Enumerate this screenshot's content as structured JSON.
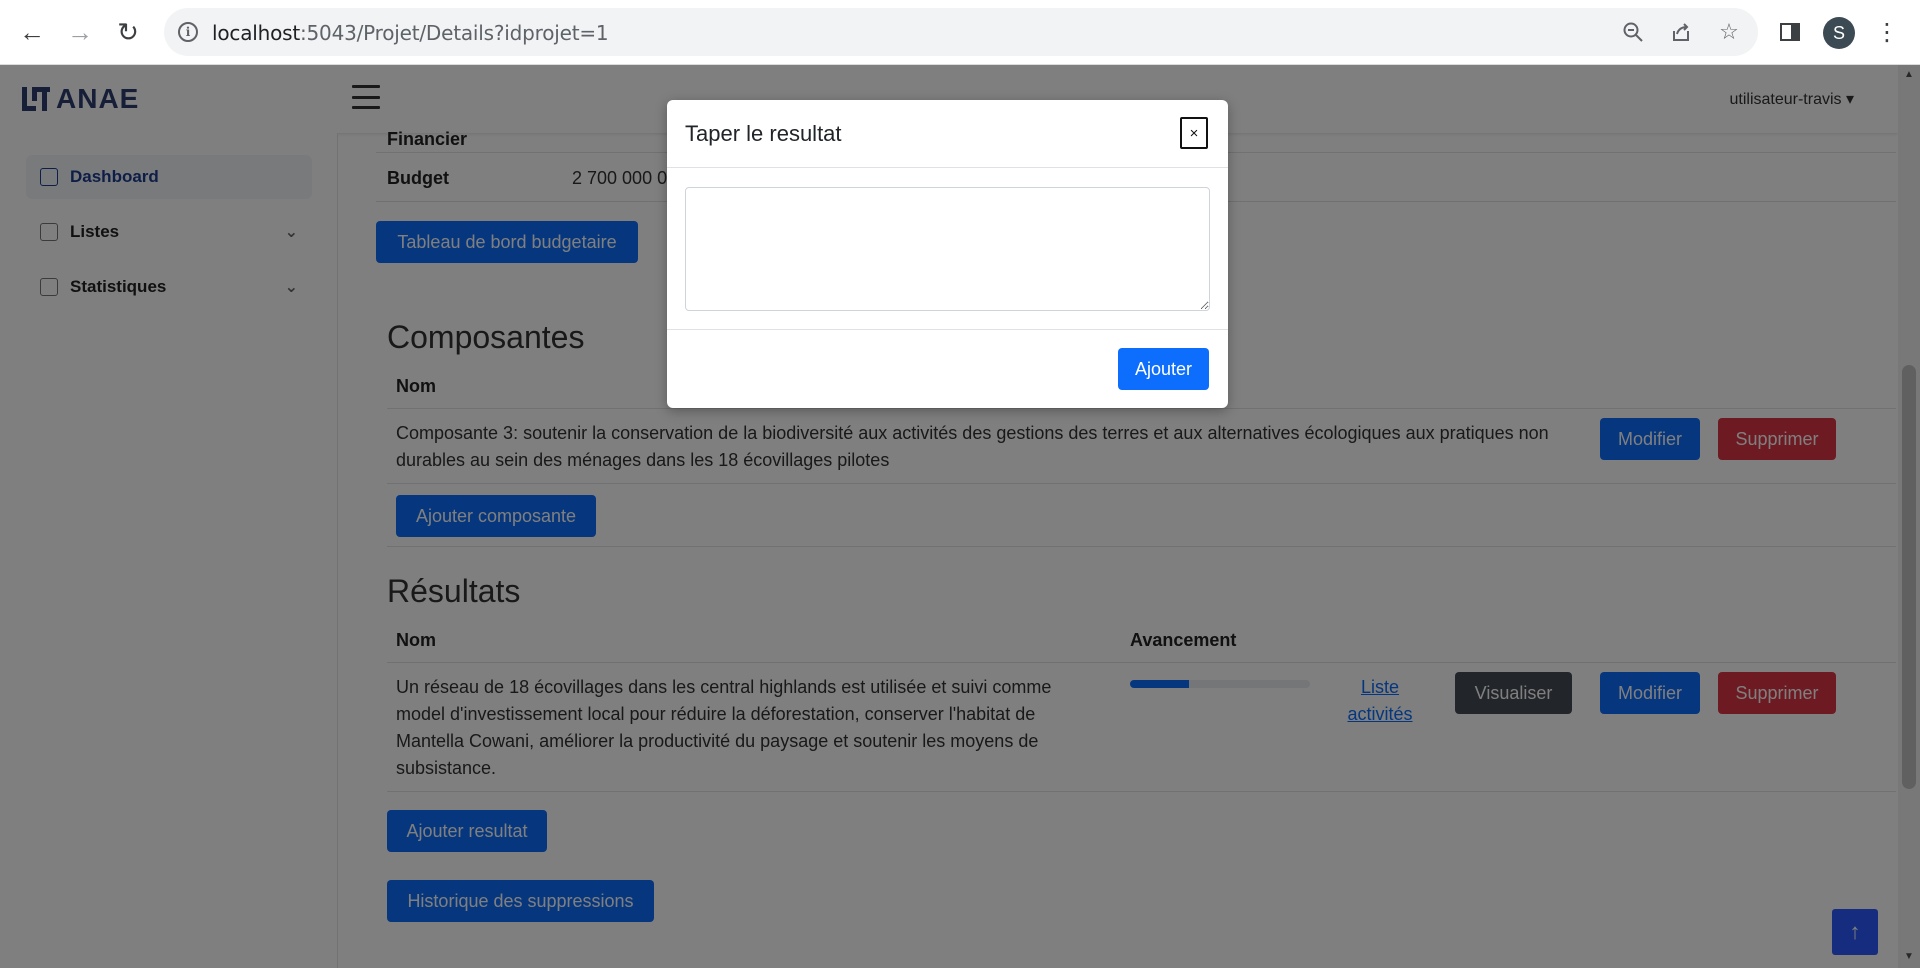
{
  "browser": {
    "url_host": "localhost",
    "url_path": ":5043/Projet/Details?idprojet=1",
    "profile_initial": "S"
  },
  "app": {
    "logo_text": "ANAE",
    "user_menu": "utilisateur-travis ▾"
  },
  "sidebar": {
    "items": [
      {
        "label": "Dashboard"
      },
      {
        "label": "Listes"
      },
      {
        "label": "Statistiques"
      }
    ]
  },
  "project": {
    "partial_label": "Financier",
    "budget_label": "Budget",
    "budget_value": "2 700 000 0",
    "dashboard_button": "Tableau de bord budgetaire"
  },
  "composantes": {
    "title": "Composantes",
    "col_nom": "Nom",
    "rows": [
      {
        "nom": "Composante 3: soutenir la conservation de la biodiversité aux activités des gestions des terres et aux alternatives écologiques aux pratiques non durables au sein des ménages dans les 18 écovillages pilotes"
      }
    ],
    "edit_label": "Modifier",
    "delete_label": "Supprimer",
    "add_button": "Ajouter composante"
  },
  "resultats": {
    "title": "Résultats",
    "col_nom": "Nom",
    "col_avancement": "Avancement",
    "rows": [
      {
        "nom": "Un réseau de 18 écovillages dans les central highlands est utilisée et suivi comme model d'investissement local pour réduire la déforestation, conserver l'habitat de Mantella Cowani, améliorer la productivité du paysage et soutenir les moyens de subsistance.",
        "avancement": 0.33,
        "activities_link": "Liste activités",
        "view_label": "Visualiser",
        "edit_label": "Modifier",
        "delete_label": "Supprimer"
      }
    ],
    "add_button": "Ajouter resultat",
    "history_button": "Historique des suppressions"
  },
  "modal": {
    "title": "Taper le resultat",
    "close_label": "×",
    "textarea_value": "",
    "submit_label": "Ajouter"
  },
  "colors": {
    "primary": "#0d6efd",
    "danger": "#dc3545",
    "brand": "#2c3e6e"
  }
}
